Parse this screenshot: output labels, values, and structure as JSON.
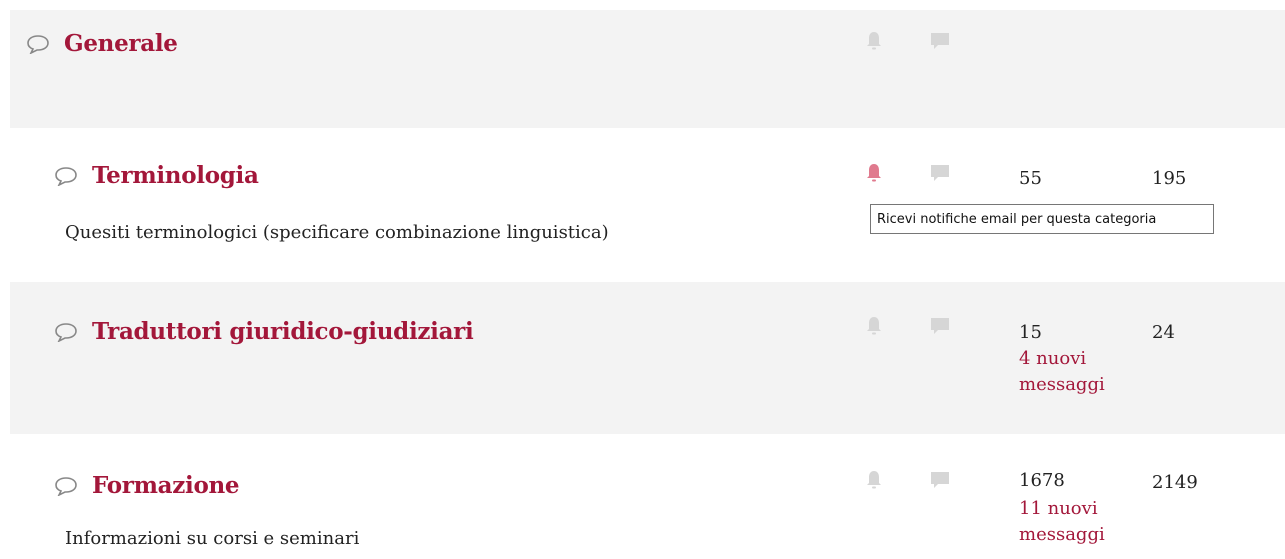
{
  "colors": {
    "accent": "#a3173a",
    "muted_icon": "#d6d6d6",
    "active_bell": "#e07a8e",
    "shaded_row": "#f3f3f3"
  },
  "icons": {
    "bubble": "speech-bubble-icon",
    "bell": "bell-icon",
    "chat": "chat-icon"
  },
  "categories": [
    {
      "title": "Generale",
      "description": "",
      "topics": "",
      "posts": "",
      "new_posts": ""
    },
    {
      "title": "Terminologia",
      "description": "Quesiti terminologici (specificare combinazione linguistica)",
      "topics": "55",
      "posts": "195",
      "new_posts": ""
    },
    {
      "title": "Traduttori giuridico-giudiziari",
      "description": "",
      "topics": "15",
      "posts": "24",
      "new_posts": "4 nuovi messaggi"
    },
    {
      "title": "Formazione",
      "description": "Informazioni su corsi e seminari",
      "topics": "1678",
      "posts": "2149",
      "new_posts": "11 nuovi messaggi"
    }
  ],
  "tooltip": {
    "text": "Ricevi notifiche email per questa categoria"
  }
}
